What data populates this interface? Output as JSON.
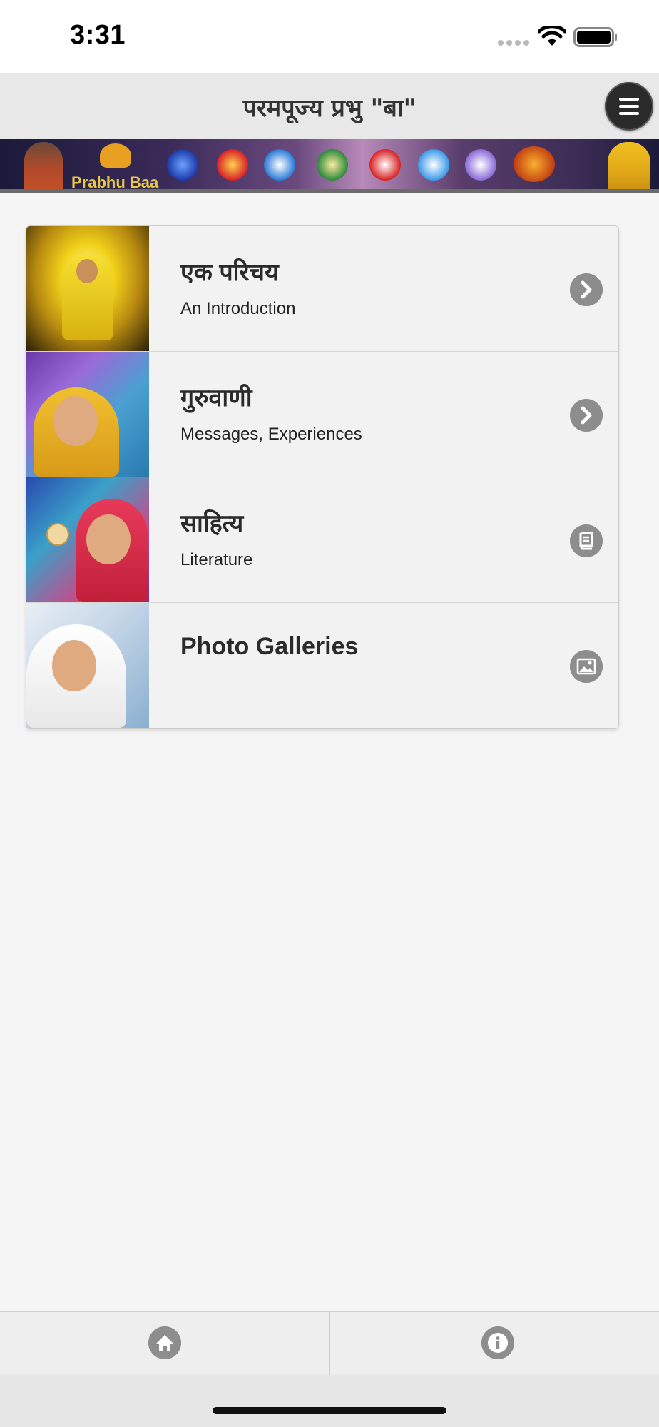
{
  "status_bar": {
    "time": "3:31"
  },
  "header": {
    "title": "परमपूज्य प्रभु \"बा\"",
    "menu_icon": "hamburger-menu-icon"
  },
  "banner": {
    "logo_text": "Prabhu Baa"
  },
  "list": {
    "items": [
      {
        "title": "एक परिचय",
        "subtitle": "An Introduction",
        "icon": "chevron-right-icon"
      },
      {
        "title": "गुरुवाणी",
        "subtitle": "Messages, Experiences",
        "icon": "chevron-right-icon"
      },
      {
        "title": "साहित्य",
        "subtitle": "Literature",
        "icon": "book-icon"
      },
      {
        "title": "Photo Galleries",
        "subtitle": "",
        "icon": "image-icon"
      }
    ]
  },
  "footer": {
    "home_icon": "home-icon",
    "info_icon": "info-icon"
  },
  "colors": {
    "header_bg": "#e8e8e8",
    "list_bg": "#f2f2f2",
    "icon_gray": "#8d8d8d",
    "menu_button": "#2a2a2a"
  }
}
